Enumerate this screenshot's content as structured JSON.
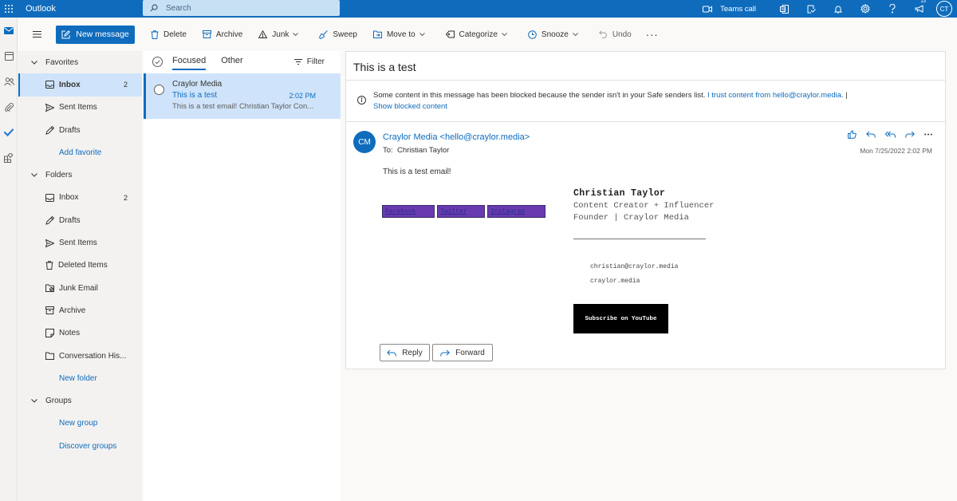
{
  "topbar": {
    "app_title": "Outlook",
    "search_placeholder": "Search",
    "teams_call": "Teams call",
    "notification_count": "13",
    "user_initials": "CT"
  },
  "commands": {
    "new_message": "New message",
    "delete": "Delete",
    "archive": "Archive",
    "junk": "Junk",
    "sweep": "Sweep",
    "move_to": "Move to",
    "categorize": "Categorize",
    "snooze": "Snooze",
    "undo": "Undo",
    "more": "···"
  },
  "folders": {
    "favorites_label": "Favorites",
    "favorites": [
      {
        "label": "Inbox",
        "count": "2"
      },
      {
        "label": "Sent Items",
        "count": ""
      },
      {
        "label": "Drafts",
        "count": ""
      }
    ],
    "add_favorite": "Add favorite",
    "folders_label": "Folders",
    "items": [
      {
        "label": "Inbox",
        "count": "2"
      },
      {
        "label": "Drafts",
        "count": ""
      },
      {
        "label": "Sent Items",
        "count": ""
      },
      {
        "label": "Deleted Items",
        "count": ""
      },
      {
        "label": "Junk Email",
        "count": ""
      },
      {
        "label": "Archive",
        "count": ""
      },
      {
        "label": "Notes",
        "count": ""
      },
      {
        "label": "Conversation His...",
        "count": ""
      }
    ],
    "new_folder": "New folder",
    "groups_label": "Groups",
    "new_group": "New group",
    "discover_groups": "Discover groups"
  },
  "message_list": {
    "tab_focused": "Focused",
    "tab_other": "Other",
    "filter": "Filter",
    "messages": [
      {
        "from": "Craylor Media",
        "subject": "This is a test",
        "time": "2:02 PM",
        "preview": "This is a test email! Christian Taylor Con..."
      }
    ]
  },
  "reading": {
    "subject": "This is a test",
    "blocked_text": "Some content in this message has been blocked because the sender isn't in your Safe senders list. ",
    "trust_link": "I trust content from hello@craylor.media.",
    "trust_sep": " |",
    "show_blocked": "Show blocked content",
    "avatar_initials": "CM",
    "sender": "Craylor Media <hello@craylor.media>",
    "to_label": "To:",
    "to_name": "Christian Taylor",
    "date": "Mon 7/25/2022 2:02 PM",
    "body": "This is a test email!",
    "social_images": [
      "Facebook",
      "Twitter",
      "Instagram"
    ],
    "sig_name": "Christian Taylor",
    "sig_title": "Content Creator + Influencer",
    "sig_company": "Founder | Craylor Media",
    "sig_email": "christian@craylor.media",
    "sig_site": "craylor.media",
    "youtube_button": "Subscribe on YouTube",
    "reply": "Reply",
    "forward": "Forward"
  },
  "colors": {
    "brand": "#0f6cbd",
    "selected": "#cfe4fa",
    "search_bg": "#c7e0f4"
  },
  "icons": [
    "waffle-icon",
    "search-icon",
    "video-icon",
    "word-icon",
    "todo-icon",
    "bell-icon",
    "gear-icon",
    "help-icon",
    "megaphone-icon",
    "mail-icon",
    "calendar-icon",
    "people-icon",
    "attach-icon",
    "checkmark-icon",
    "apps-icon"
  ]
}
